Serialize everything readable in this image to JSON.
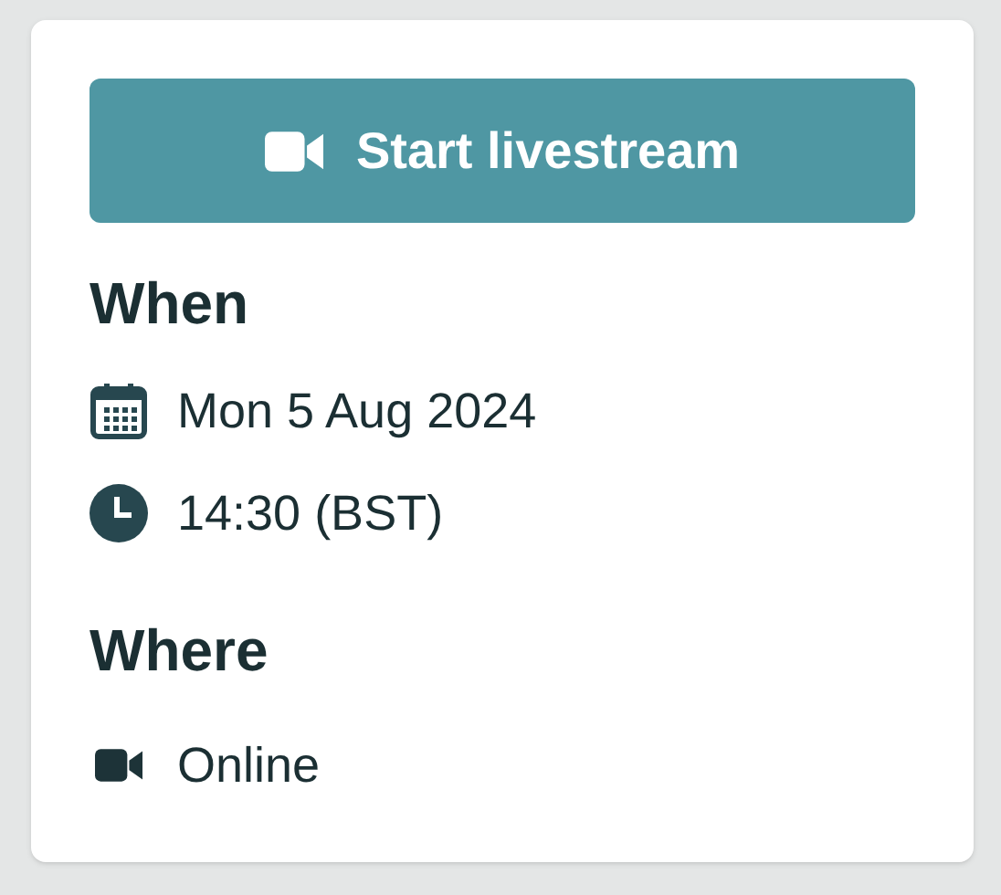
{
  "button": {
    "label": "Start livestream"
  },
  "sections": [
    {
      "heading": "When",
      "items": [
        {
          "kind": "date",
          "text": "Mon 5 Aug 2024"
        },
        {
          "kind": "time",
          "text": "14:30 (BST)"
        }
      ]
    },
    {
      "heading": "Where",
      "items": [
        {
          "kind": "video",
          "text": "Online"
        }
      ]
    }
  ]
}
